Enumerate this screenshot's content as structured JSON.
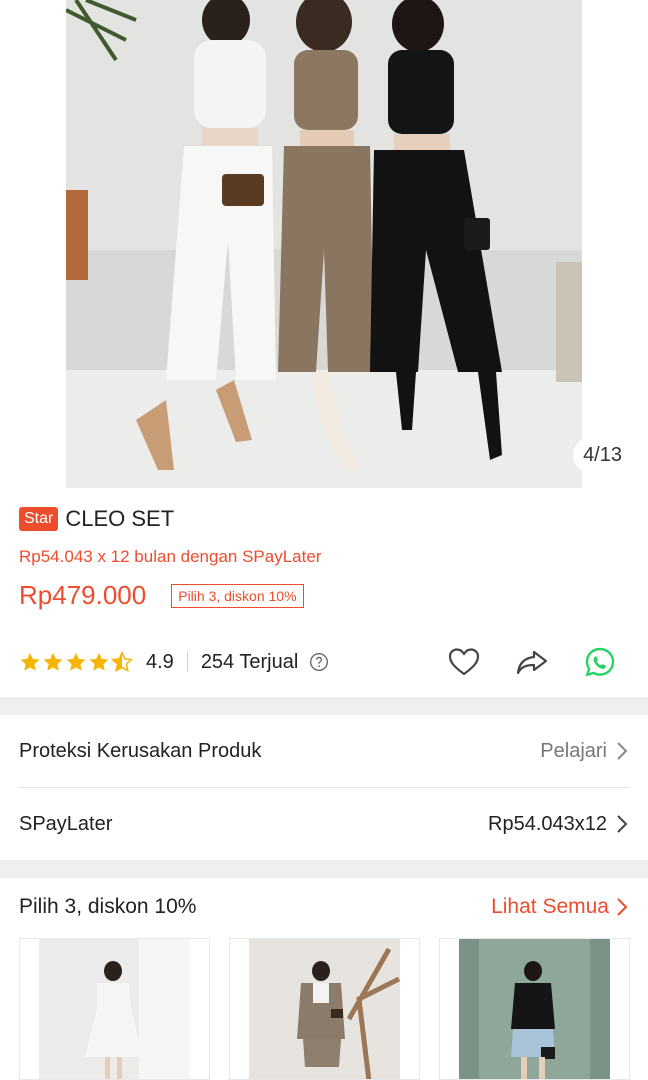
{
  "gallery": {
    "counter": "4/13"
  },
  "product": {
    "badge": "Star",
    "title": "CLEO SET",
    "paylater_line": "Rp54.043 x 12 bulan dengan SPayLater",
    "price": "Rp479.000",
    "promo_tag": "Pilih 3, diskon 10%",
    "rating": "4.9",
    "sold": "254 Terjual",
    "rating_stars": 4.5
  },
  "rows": {
    "protection": {
      "label": "Proteksi Kerusakan Produk",
      "action": "Pelajari"
    },
    "spaylater": {
      "label": "SPayLater",
      "value": "Rp54.043x12"
    }
  },
  "bundle": {
    "title": "Pilih 3, diskon 10%",
    "see_all": "Lihat Semua"
  },
  "colors": {
    "accent": "#ee4d2d",
    "whatsapp": "#25d366",
    "star": "#f7b500"
  },
  "icons": [
    "star-icon",
    "help-icon",
    "heart-icon",
    "share-icon",
    "whatsapp-icon",
    "chevron-right-icon"
  ]
}
